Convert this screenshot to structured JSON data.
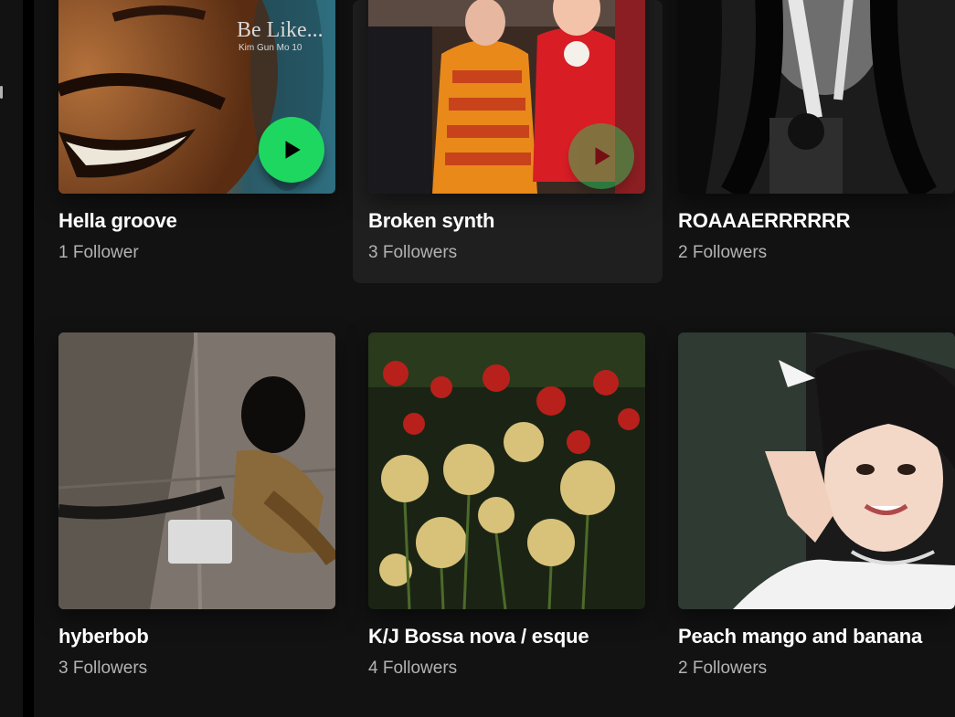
{
  "playlists_row1": [
    {
      "title": "Hella groove",
      "followers": "1 Follower",
      "cover_title": "Be Like...",
      "cover_subtitle": "Kim Gun Mo 10"
    },
    {
      "title": "Broken synth",
      "followers": "3 Followers",
      "cover_title": "",
      "cover_subtitle": ""
    },
    {
      "title": "ROAAAERRRRRR",
      "followers": "2 Followers"
    }
  ],
  "playlists_row2": [
    {
      "title": "hyberbob",
      "followers": "3 Followers"
    },
    {
      "title": "K/J Bossa nova / esque",
      "followers": "4 Followers"
    },
    {
      "title": "Peach mango and banana",
      "followers": "2 Followers"
    }
  ],
  "icons": {
    "play": "play-icon"
  },
  "colors": {
    "accent": "#1ed760",
    "background": "#121212",
    "hover_card": "#1f1f1f",
    "subtext": "#b3b3b3"
  }
}
